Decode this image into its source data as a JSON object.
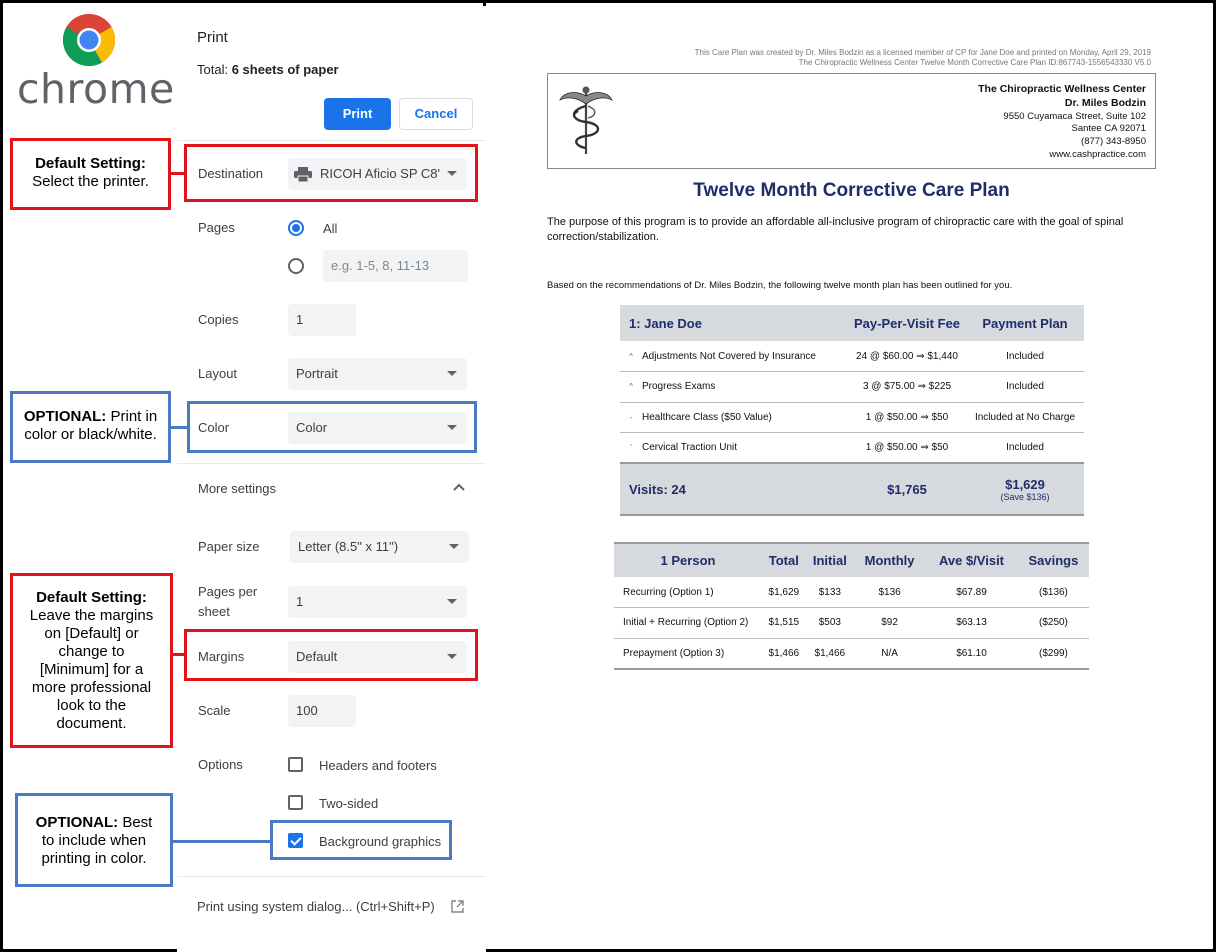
{
  "brand": {
    "word": "chrome"
  },
  "print_panel": {
    "title": "Print",
    "total_prefix": "Total: ",
    "total_value": "6 sheets of paper",
    "print_button": "Print",
    "cancel_button": "Cancel",
    "destination": {
      "label": "Destination",
      "value": "RICOH Aficio SP C8'"
    },
    "pages": {
      "label": "Pages",
      "all_option": "All",
      "custom_placeholder": "e.g. 1-5, 8, 11-13"
    },
    "copies": {
      "label": "Copies",
      "value": "1"
    },
    "layout": {
      "label": "Layout",
      "value": "Portrait"
    },
    "color": {
      "label": "Color",
      "value": "Color"
    },
    "more_settings": "More settings",
    "paper_size": {
      "label": "Paper size",
      "value": "Letter (8.5\" x 11\")"
    },
    "pages_per_sheet": {
      "label_line1": "Pages per",
      "label_line2": "sheet",
      "value": "1"
    },
    "margins": {
      "label": "Margins",
      "value": "Default"
    },
    "scale": {
      "label": "Scale",
      "value": "100"
    },
    "options": {
      "label": "Options",
      "headers_footers": "Headers and footers",
      "two_sided": "Two-sided",
      "background_graphics": "Background graphics"
    },
    "system_dialog": "Print using system dialog... (Ctrl+Shift+P)"
  },
  "callouts": {
    "destination": {
      "bold": "Default Setting:",
      "text": "Select the printer."
    },
    "color": {
      "bold": "OPTIONAL:",
      "text_a": " Print in",
      "text_b": "color or black/white."
    },
    "margins": {
      "bold": "Default Setting:",
      "l1": "Leave the margins",
      "l2": "on [Default] or",
      "l3": "change to",
      "l4": "[Minimum] for a",
      "l5": "more professional",
      "l6": "look to the",
      "l7": "document."
    },
    "background": {
      "bold": "OPTIONAL:",
      "text_a": " Best",
      "text_b": "to include when",
      "text_c": "printing in color."
    }
  },
  "document": {
    "meta_line1": "This Care Plan was created by Dr. Miles Bodzin as a licensed member of CP for Jane Doe and printed on Monday, April 29, 2019",
    "meta_line2": "The Chiropractic Wellness Center Twelve Month Corrective Care Plan ID:867743-1556543330 V5.0",
    "clinic_name": "The Chiropractic Wellness Center",
    "doctor": "Dr. Miles Bodzin",
    "address1": "9550 Cuyamaca Street, Suite 102",
    "address2": "Santee CA 92071",
    "phone": "(877) 343-8950",
    "website": "www.cashpractice.com",
    "title": "Twelve Month Corrective Care Plan",
    "purpose": "The purpose of this program is to provide an affordable all-inclusive program of chiropractic care with the goal of spinal correction/stabilization.",
    "basis": "Based on the recommendations of Dr. Miles Bodzin, the following twelve month plan has been outlined for you.",
    "plan_table": {
      "headers": [
        "1: Jane Doe",
        "Pay-Per-Visit Fee",
        "Payment Plan"
      ],
      "rows": [
        {
          "bullet": "^",
          "item": "Adjustments Not Covered by Insurance",
          "fee": "24 @ $60.00 ⇒ $1,440",
          "plan": "Included"
        },
        {
          "bullet": "^",
          "item": "Progress Exams",
          "fee": "3 @ $75.00 ⇒ $225",
          "plan": "Included"
        },
        {
          "bullet": "-",
          "item": "Healthcare Class ($50 Value)",
          "fee": "1 @ $50.00 ⇒ $50",
          "plan": "Included at No Charge"
        },
        {
          "bullet": "'",
          "item": "Cervical Traction Unit",
          "fee": "1 @ $50.00 ⇒ $50",
          "plan": "Included"
        }
      ],
      "footer": {
        "visits": "Visits: 24",
        "ppv_total": "$1,765",
        "plan_total": "$1,629",
        "savings": "(Save $136)"
      }
    },
    "options_table": {
      "headers": [
        "1 Person",
        "Total",
        "Initial",
        "Monthly",
        "Ave $/Visit",
        "Savings"
      ],
      "rows": [
        [
          "Recurring (Option 1)",
          "$1,629",
          "$133",
          "$136",
          "$67.89",
          "($136)"
        ],
        [
          "Initial + Recurring (Option 2)",
          "$1,515",
          "$503",
          "$92",
          "$63.13",
          "($250)"
        ],
        [
          "Prepayment (Option 3)",
          "$1,466",
          "$1,466",
          "N/A",
          "$61.10",
          "($299)"
        ]
      ]
    }
  }
}
